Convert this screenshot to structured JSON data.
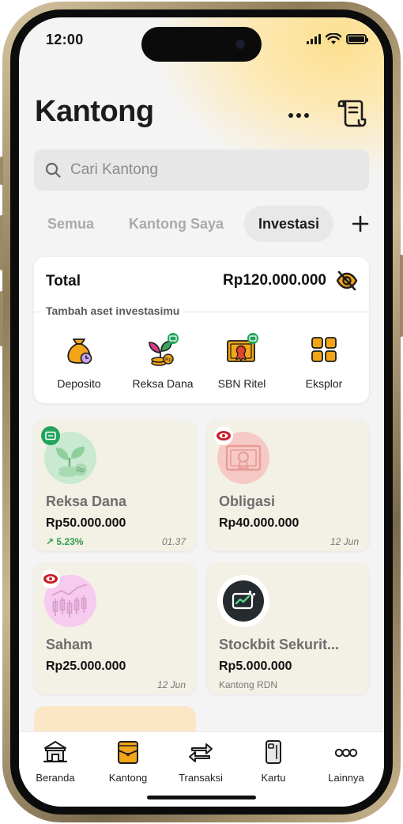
{
  "status": {
    "time": "12:00"
  },
  "page": {
    "title": "Kantong"
  },
  "search": {
    "placeholder": "Cari Kantong"
  },
  "tabs": [
    {
      "label": "Semua",
      "active": false
    },
    {
      "label": "Kantong Saya",
      "active": false
    },
    {
      "label": "Investasi",
      "active": true
    }
  ],
  "summary": {
    "label": "Total",
    "value": "Rp120.000.000",
    "section_label": "Tambah aset investasimu",
    "quick_actions": [
      {
        "label": "Deposito",
        "icon": "money-bag-icon"
      },
      {
        "label": "Reksa Dana",
        "icon": "plant-coins-icon"
      },
      {
        "label": "SBN Ritel",
        "icon": "certificate-icon"
      },
      {
        "label": "Eksplor",
        "icon": "grid-icon"
      }
    ]
  },
  "investments": [
    {
      "title": "Reksa Dana",
      "amount": "Rp50.000.000",
      "change": "↗ 5.23%",
      "date": "01.37"
    },
    {
      "title": "Obligasi",
      "amount": "Rp40.000.000",
      "date": "12 Jun"
    },
    {
      "title": "Saham",
      "amount": "Rp25.000.000",
      "date": "12 Jun"
    },
    {
      "title": "Stockbit Sekurit...",
      "amount": "Rp5.000.000",
      "subtitle": "Kantong RDN"
    }
  ],
  "nav": [
    {
      "label": "Beranda",
      "icon": "bank-icon"
    },
    {
      "label": "Kantong",
      "icon": "wallet-icon"
    },
    {
      "label": "Transaksi",
      "icon": "transfer-icon"
    },
    {
      "label": "Kartu",
      "icon": "card-icon"
    },
    {
      "label": "Lainnya",
      "icon": "more-circles-icon"
    }
  ],
  "colors": {
    "accent": "#f2a516",
    "gain": "#2c9c4a",
    "badge_green": "#22a45d",
    "badge_red": "#c8202a",
    "card_bg": "#f3f0e6"
  }
}
